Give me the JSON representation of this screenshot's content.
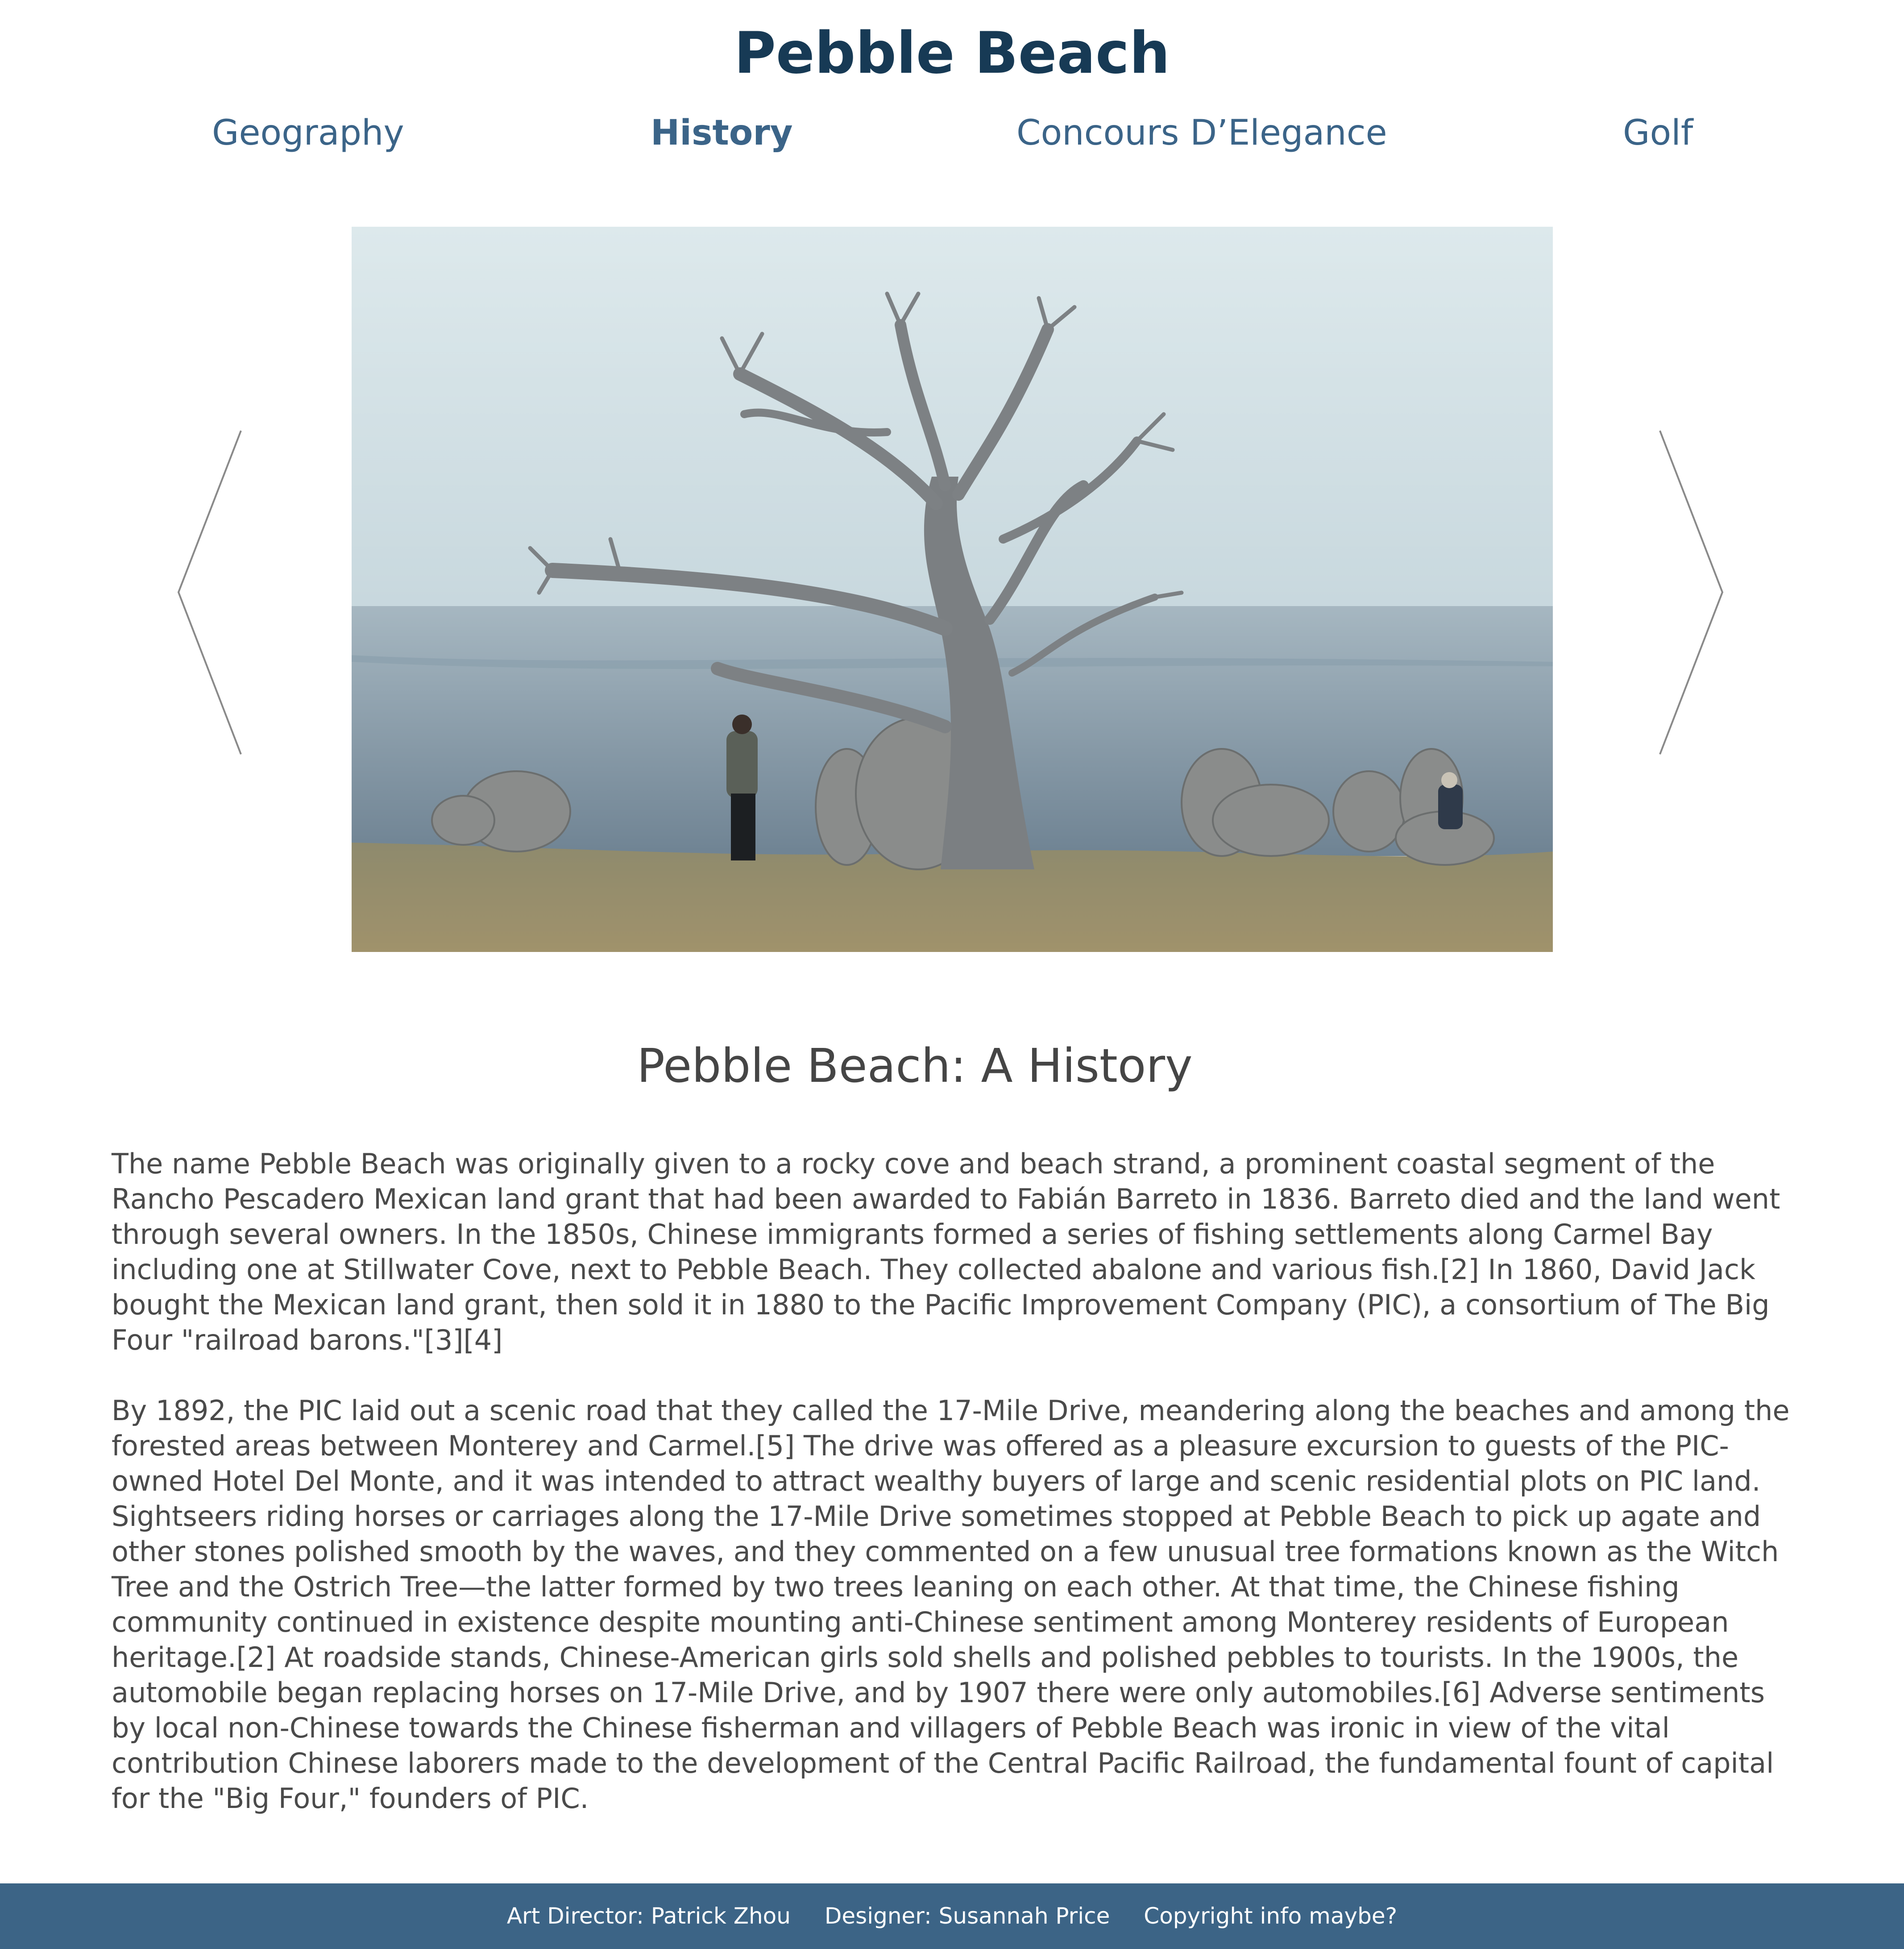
{
  "header": {
    "title": "Pebble Beach"
  },
  "nav": {
    "items": [
      {
        "label": "Geography",
        "active": false
      },
      {
        "label": "History",
        "active": true
      },
      {
        "label": "Concours D’Elegance",
        "active": false
      },
      {
        "label": "Golf",
        "active": false
      }
    ]
  },
  "carousel": {
    "prev_icon": "chevron-left-icon",
    "next_icon": "chevron-right-icon"
  },
  "article": {
    "heading": "Pebble Beach: A History",
    "paragraphs": [
      "The name Pebble Beach was originally given to a rocky cove and beach strand, a prominent coastal segment of the Rancho Pescadero Mexican land grant that had been awarded to Fabián Barreto in 1836. Barreto died and the land went through several owners. In the 1850s, Chinese immigrants formed a series of fishing settlements along Carmel Bay including one at Stillwater Cove, next to Pebble Beach. They collected abalone and various fish.[2] In 1860, David Jack bought the Mexican land grant, then sold it in 1880 to the Pacific Improvement Company (PIC), a consortium of The Big Four \"railroad barons.\"[3][4]",
      "By 1892, the PIC laid out a scenic road that they called the 17-Mile Drive, meandering along the beaches and among the forested areas between Monterey and Carmel.[5] The drive was offered as a pleasure excursion to guests of the PIC-owned Hotel Del Monte, and it was intended to attract wealthy buyers of large and scenic residential plots on PIC land. Sightseers riding horses or carriages along the 17-Mile Drive sometimes stopped at Pebble Beach to pick up agate and other stones polished smooth by the waves, and they commented on a few unusual tree formations known as the Witch Tree and the Ostrich Tree—the latter formed by two trees leaning on each other. At that time, the Chinese fishing community continued in existence despite mounting anti-Chinese sentiment among Monterey residents of European heritage.[2] At roadside stands, Chinese-American girls sold shells and polished pebbles to tourists. In the 1900s, the automobile began replacing horses on 17-Mile Drive, and by 1907 there were only automobiles.[6] Adverse sentiments by local non-Chinese towards the Chinese fisherman and villagers of Pebble Beach was ironic in view of the vital contribution Chinese laborers made to the development of the Central Pacific Railroad, the fundamental fount of capital for the \"Big Four,\" founders of PIC."
    ]
  },
  "footer": {
    "art_director": "Art Director: Patrick Zhou",
    "designer": "Designer: Susannah Price",
    "copyright": "Copyright info maybe?"
  },
  "colors": {
    "title": "#173a55",
    "nav": "#3b6488",
    "footer_bg": "#3c6486",
    "body_text": "#4a4a4a"
  }
}
